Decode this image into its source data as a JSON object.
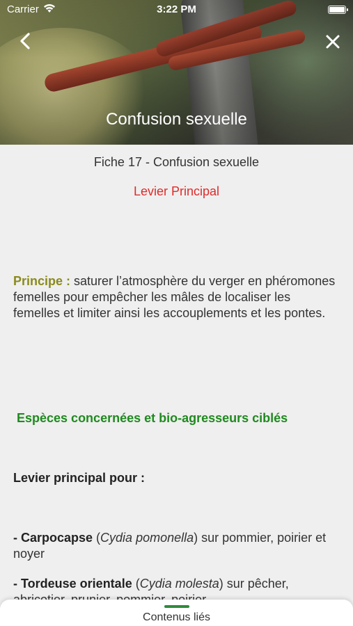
{
  "status_bar": {
    "carrier": "Carrier",
    "time": "3:22 PM"
  },
  "header": {
    "title": "Confusion sexuelle"
  },
  "content": {
    "sheet_title": "Fiche 17 - Confusion sexuelle",
    "lever": "Levier Principal",
    "principle_label": "Principe :",
    "principle_text": " saturer l’atmosphère du verger en phéromones femelles pour empêcher les mâles de localiser les femelles et limiter ainsi les accouplements et les pontes.",
    "species_heading": "Espèces concernées et bio-agresseurs ciblés",
    "lever_for": "Levier principal pour :",
    "pests": [
      {
        "name": "- Carpocapse",
        "latin": "Cydia pomonella",
        "hosts": "sur pommier, poirier et noyer"
      },
      {
        "name": "- Tordeuse orientale",
        "latin": "Cydia molesta",
        "hosts": "sur pêcher, abricotier, prunier, pommier, poirier"
      }
    ]
  },
  "bottom_sheet": {
    "label": "Contenus liés"
  },
  "colors": {
    "lever": "#e02a2a",
    "principle_label": "#8a8a1e",
    "species": "#1f8a1f",
    "handle": "#2e8b3c"
  }
}
